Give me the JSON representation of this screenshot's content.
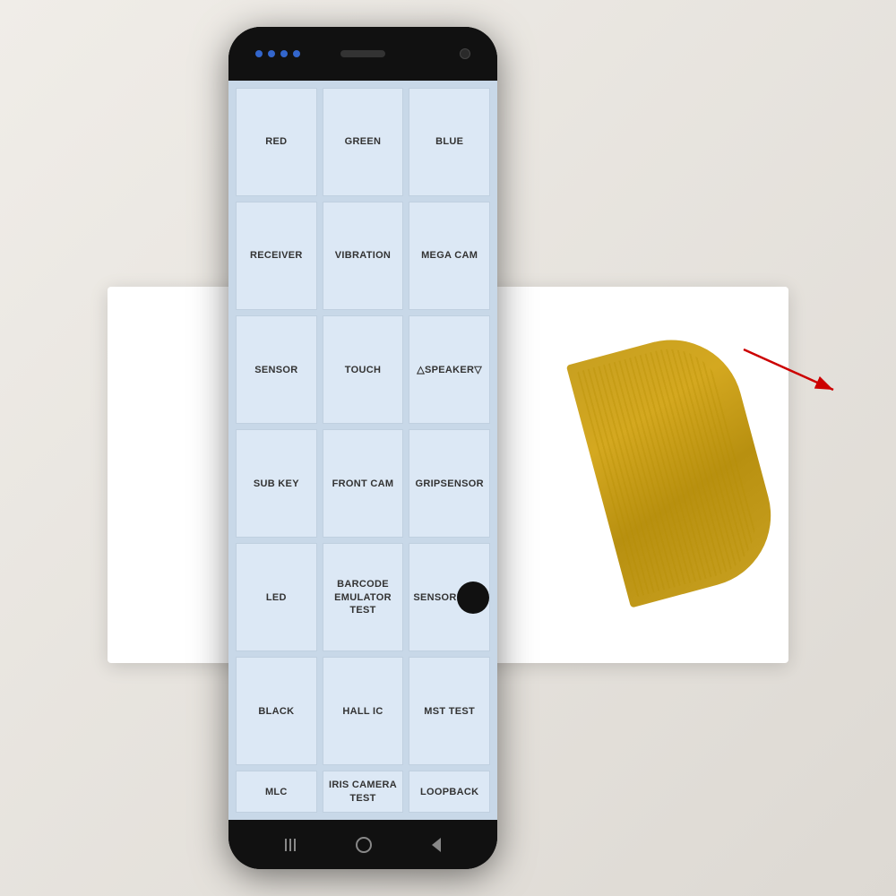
{
  "scene": {
    "background_color": "#e8e4df"
  },
  "phone": {
    "grid_cells": [
      {
        "id": "red",
        "label": "RED",
        "row": 1,
        "col": 1
      },
      {
        "id": "green",
        "label": "GREEN",
        "row": 1,
        "col": 2
      },
      {
        "id": "blue",
        "label": "BLUE",
        "row": 1,
        "col": 3
      },
      {
        "id": "receiver",
        "label": "RECEIVER",
        "row": 2,
        "col": 1
      },
      {
        "id": "vibration",
        "label": "VIBRATION",
        "row": 2,
        "col": 2
      },
      {
        "id": "mega-cam",
        "label": "MEGA CAM",
        "row": 2,
        "col": 3
      },
      {
        "id": "sensor",
        "label": "SENSOR",
        "row": 3,
        "col": 1
      },
      {
        "id": "touch",
        "label": "TOUCH",
        "row": 3,
        "col": 2
      },
      {
        "id": "speaker",
        "label": "△SPEAKER▽",
        "row": 3,
        "col": 3
      },
      {
        "id": "sub-key",
        "label": "SUB KEY",
        "row": 4,
        "col": 1
      },
      {
        "id": "front-cam",
        "label": "FRONT CAM",
        "row": 4,
        "col": 2
      },
      {
        "id": "gripsensor",
        "label": "GRIPSENSOR",
        "row": 4,
        "col": 3
      },
      {
        "id": "led",
        "label": "LED",
        "row": 5,
        "col": 1
      },
      {
        "id": "barcode-emulator",
        "label": "BARCODE\nEMULATOR TEST",
        "row": 5,
        "col": 2
      },
      {
        "id": "sensorhub",
        "label": "SENSORHUB TE",
        "row": 5,
        "col": 3
      },
      {
        "id": "black",
        "label": "BLACK",
        "row": 6,
        "col": 1
      },
      {
        "id": "hall-ic",
        "label": "HALL IC",
        "row": 6,
        "col": 2
      },
      {
        "id": "mst-test",
        "label": "MST TEST",
        "row": 6,
        "col": 3
      },
      {
        "id": "mlc",
        "label": "MLC",
        "row": 7,
        "col": 1
      },
      {
        "id": "iris-camera",
        "label": "IRIS CAMERA\nTEST",
        "row": 7,
        "col": 2
      },
      {
        "id": "loopback",
        "label": "LOOPBACK",
        "row": 7,
        "col": 3
      }
    ],
    "nav": {
      "recent_label": "|||",
      "home_label": "○",
      "back_label": "<"
    }
  }
}
